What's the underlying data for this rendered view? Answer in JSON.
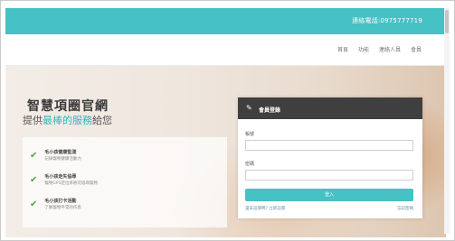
{
  "topbar": {
    "phone": "連絡電話:0975777719",
    "accent": "#46c1c4"
  },
  "nav": {
    "items": [
      "首頁",
      "功能",
      "連絡人員",
      "會員"
    ]
  },
  "hero": {
    "title": "智慧項圈官網",
    "subtitle_prefix": "提供",
    "subtitle_highlight": "最棒的服務",
    "subtitle_suffix": "給您"
  },
  "features": [
    {
      "title": "毛小孩健康監測",
      "desc": "記錄寵物健康活動力"
    },
    {
      "title": "毛小孩走失協尋",
      "desc": "寵物GPS定位系統可協尋寵物"
    },
    {
      "title": "毛小孩打卡活動",
      "desc": "了解寵物平常的作息"
    }
  ],
  "login": {
    "heading": "會員登錄",
    "account_label": "帳號",
    "password_label": "密碼",
    "account_value": "",
    "password_value": "",
    "submit_label": "登入",
    "register_link": "還未註冊嗎? 立即註冊",
    "forgot_link": "忘記密碼"
  }
}
